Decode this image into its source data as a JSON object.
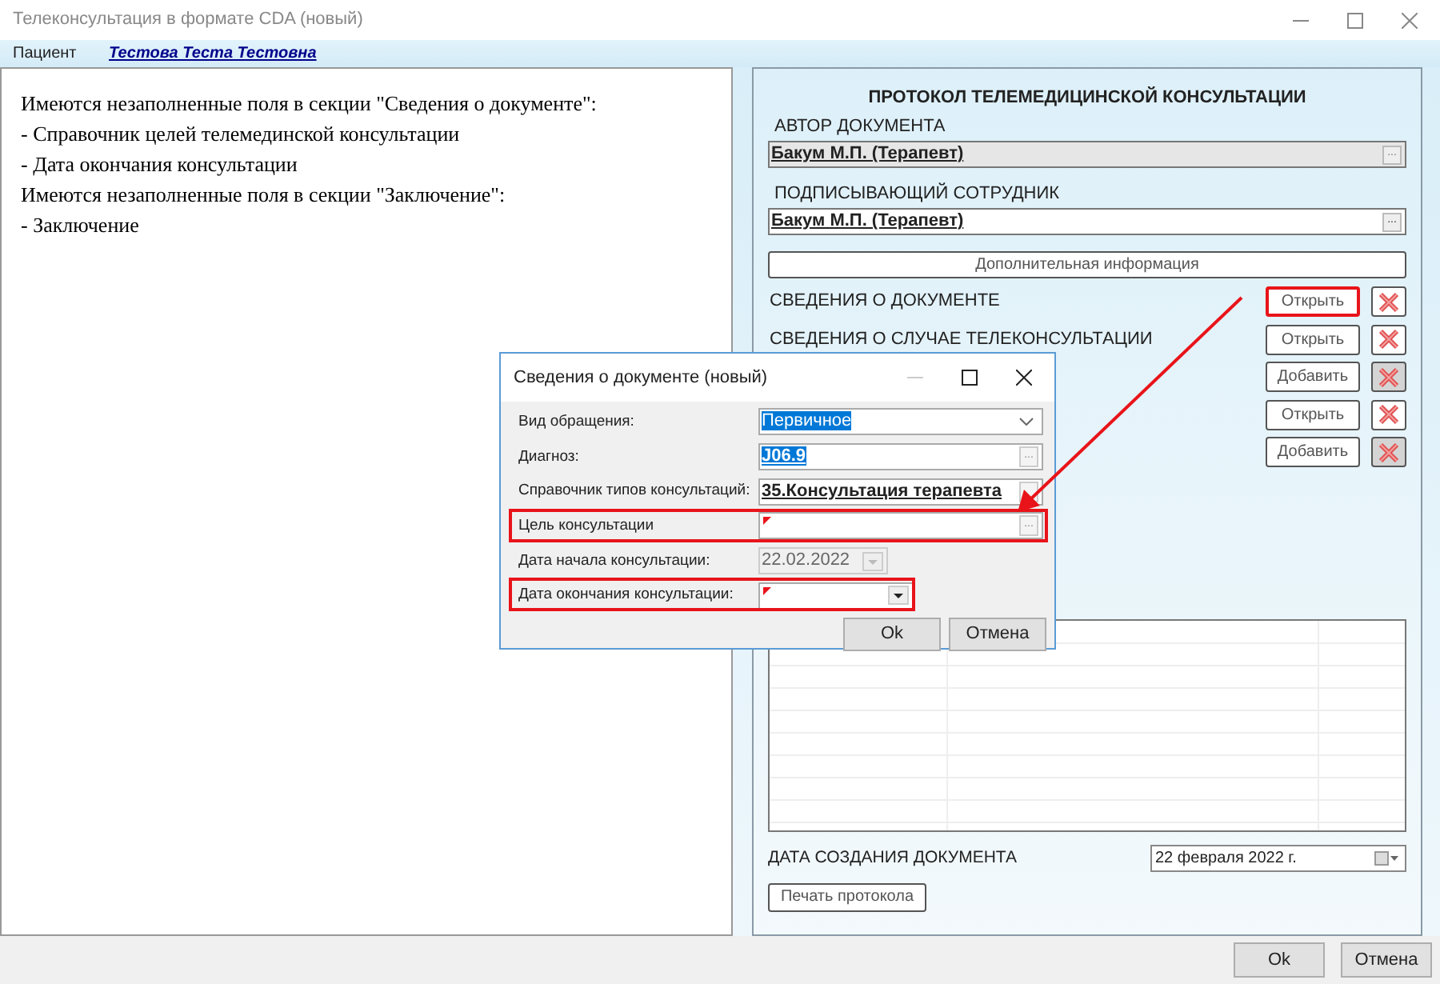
{
  "window": {
    "title": "Телеконсультация в формате CDA (новый)"
  },
  "patient": {
    "label": "Пациент",
    "name": "Тестова Теста Тестовна"
  },
  "messages": [
    "Имеются незаполненные поля в секции \"Сведения о документе\":",
    "- Справочник целей телемединской консультации",
    "- Дата окончания консультации",
    "Имеются незаполненные поля в секции \"Заключение\":",
    "- Заключение"
  ],
  "protocol": {
    "title": "ПРОТОКОЛ ТЕЛЕМЕДИЦИНСКОЙ КОНСУЛЬТАЦИИ",
    "author": {
      "label": "АВТОР ДОКУМЕНТА",
      "value": "Бакум М.П. (Терапевт)",
      "disabled": true,
      "button": "..."
    },
    "signer": {
      "label": "ПОДПИСЫВАЮЩИЙ СОТРУДНИК",
      "value": "Бакум М.П. (Терапевт)",
      "disabled": false,
      "button": "..."
    },
    "extra_button": "Дополнительная информация",
    "sections": [
      {
        "label": "СВЕДЕНИЯ О ДОКУМЕНТЕ",
        "button": "Открыть",
        "highlighted": true,
        "delete_disabled": false
      },
      {
        "label": "СВЕДЕНИЯ О СЛУЧАЕ ТЕЛЕКОНСУЛЬТАЦИИ",
        "button": "Открыть",
        "highlighted": false,
        "delete_disabled": false
      },
      {
        "button": "Добавить",
        "highlighted": false,
        "delete_disabled": true
      },
      {
        "button": "Открыть",
        "highlighted": false,
        "delete_disabled": false
      },
      {
        "button": "Добавить",
        "highlighted": false,
        "delete_disabled": true
      }
    ],
    "created": {
      "label": "ДАТА СОЗДАНИЯ ДОКУМЕНТА",
      "value": "22 февраля  2022 г."
    },
    "print_button": "Печать протокола"
  },
  "dialog": {
    "title": "Сведения о документе (новый)",
    "fields": [
      {
        "label": "Вид обращения:",
        "kind": "select",
        "value": "Первичное",
        "text_selected": true,
        "required": false,
        "disabled": false,
        "highlighted": false
      },
      {
        "label": "Диагноз:",
        "kind": "lookup",
        "value": "J06.9",
        "text_selected": true,
        "required": false,
        "disabled": false,
        "highlighted": false,
        "button": "..."
      },
      {
        "label": "Справочник типов консультаций:",
        "kind": "lookup",
        "value": "35.Консультация  терапевта",
        "text_selected": false,
        "required": false,
        "disabled": false,
        "highlighted": false
      },
      {
        "label": "Цель консультации",
        "kind": "lookup",
        "required": true,
        "disabled": false,
        "highlighted": true,
        "button": "..."
      },
      {
        "label": "Дата начала консультации:",
        "kind": "date",
        "value": "22.02.2022",
        "text_selected": false,
        "required": false,
        "disabled": true,
        "highlighted": false
      },
      {
        "label": "Дата окончания консультации:",
        "kind": "date",
        "required": true,
        "disabled": false,
        "highlighted": true
      }
    ],
    "buttons": [
      "Ok",
      "Отмена"
    ]
  },
  "footer": {
    "buttons": [
      "Ok",
      "Отмена"
    ]
  }
}
